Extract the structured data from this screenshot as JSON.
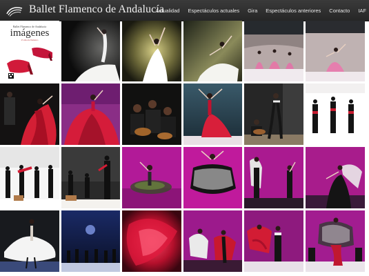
{
  "header": {
    "site_title": "Ballet Flamenco de Andalucía",
    "logo_icon": "flamenco-logo-icon",
    "nav": [
      {
        "id": "actualidad",
        "label": "Actualidad"
      },
      {
        "id": "espectaculos-actuales",
        "label": "Espectáculos actuales"
      },
      {
        "id": "gira",
        "label": "Gira"
      },
      {
        "id": "espectaculos-anteriores",
        "label": "Espectáculos anteriores"
      },
      {
        "id": "contacto",
        "label": "Contacto"
      },
      {
        "id": "iaf",
        "label": "IAF"
      }
    ]
  },
  "poster": {
    "subtitle": "Ballet Flamenco de Andalucía",
    "title": "imágenes",
    "tagline": "25 años de flamenco"
  },
  "colors": {
    "header_bg": "#2e2e2e",
    "header_text": "#f2f2f2",
    "flamenco_red": "#d41f35",
    "magenta_stage": "#a81c8c"
  },
  "gallery": {
    "photos": [
      {
        "id": "photo-r1c2"
      },
      {
        "id": "photo-r1c3"
      },
      {
        "id": "photo-r1c4"
      },
      {
        "id": "photo-r1c5"
      },
      {
        "id": "photo-r1c6"
      },
      {
        "id": "photo-r2c1"
      },
      {
        "id": "photo-r2c2"
      },
      {
        "id": "photo-r2c3"
      },
      {
        "id": "photo-r2c4"
      },
      {
        "id": "photo-r2c5"
      },
      {
        "id": "photo-r2c6"
      },
      {
        "id": "photo-r3c1"
      },
      {
        "id": "photo-r3c2"
      },
      {
        "id": "photo-r3c3"
      },
      {
        "id": "photo-r3c4"
      },
      {
        "id": "photo-r3c5"
      },
      {
        "id": "photo-r3c6"
      },
      {
        "id": "photo-r4c1"
      },
      {
        "id": "photo-r4c2"
      },
      {
        "id": "photo-r4c3"
      },
      {
        "id": "photo-r4c4"
      },
      {
        "id": "photo-r4c5"
      },
      {
        "id": "photo-r4c6"
      }
    ]
  }
}
